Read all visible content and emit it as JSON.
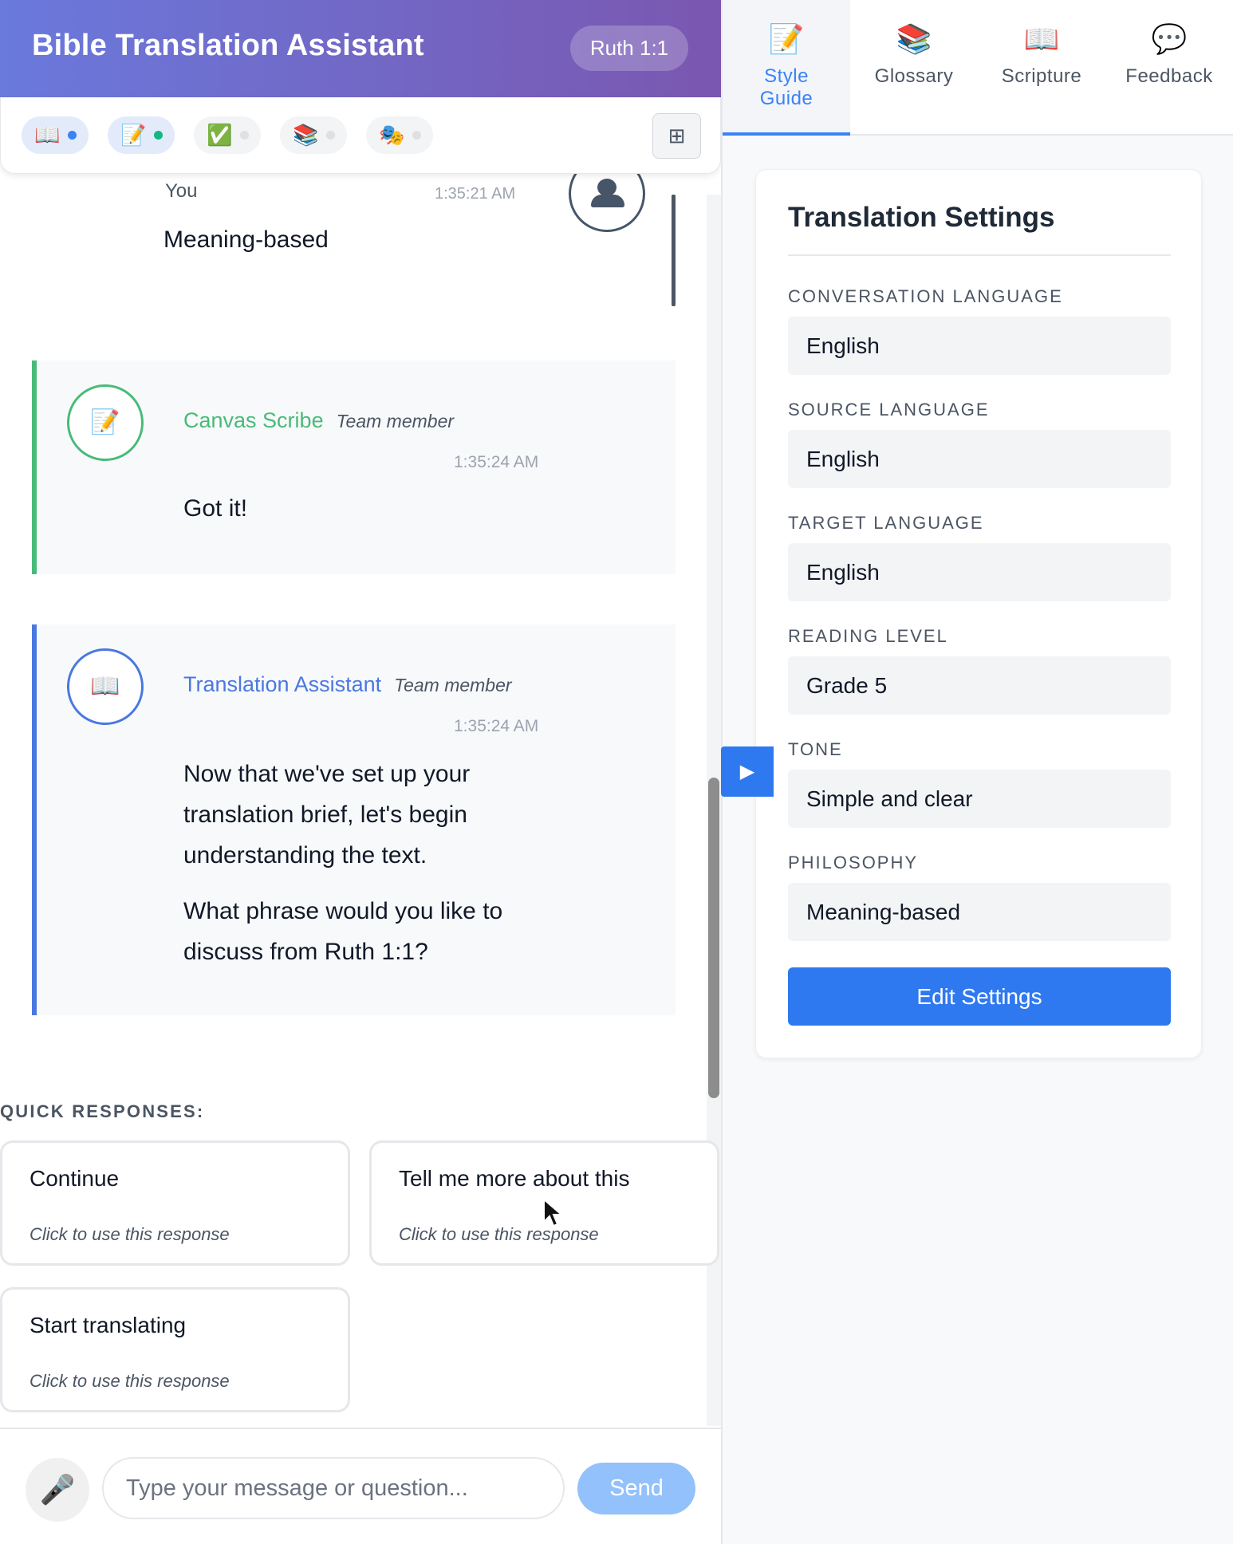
{
  "header": {
    "title": "Bible Translation Assistant",
    "reference": "Ruth 1:1"
  },
  "agent_bar": {
    "chips": [
      {
        "icon": "📖",
        "status_color": "#3b82f6"
      },
      {
        "icon": "📝",
        "status_color": "#10b981"
      },
      {
        "icon": "✅",
        "status_color": "#d1d5db"
      },
      {
        "icon": "📚",
        "status_color": "#d1d5db"
      },
      {
        "icon": "🎭",
        "status_color": "#d1d5db"
      }
    ],
    "grid_icon": "⊞"
  },
  "messages": {
    "user": {
      "name": "You",
      "time": "1:35:21 AM",
      "text": "Meaning-based"
    },
    "scribe": {
      "name": "Canvas Scribe",
      "role": "Team member",
      "time": "1:35:24 AM",
      "text": "Got it!",
      "icon": "📝",
      "color": "#48bb78"
    },
    "assistant": {
      "name": "Translation Assistant",
      "role": "Team member",
      "time": "1:35:24 AM",
      "icon": "📖",
      "color": "#4a78e0",
      "paragraph1": "Now that we've set up your translation brief, let's begin understanding the text.",
      "paragraph2": "What phrase would you like to discuss from Ruth 1:1?"
    }
  },
  "quick_responses": {
    "label": "QUICK RESPONSES:",
    "hint": "Click to use this response",
    "items": [
      "Continue",
      "Tell me more about this",
      "Start translating"
    ]
  },
  "composer": {
    "mic_icon": "🎤",
    "placeholder": "Type your message or question...",
    "send_label": "Send"
  },
  "tabs": [
    {
      "icon": "📝",
      "label": "Style Guide",
      "active": true
    },
    {
      "icon": "📚",
      "label": "Glossary",
      "active": false
    },
    {
      "icon": "📖",
      "label": "Scripture",
      "active": false
    },
    {
      "icon": "💬",
      "label": "Feedback",
      "active": false
    }
  ],
  "toggle": "▶",
  "settings": {
    "title": "Translation Settings",
    "fields": [
      {
        "label": "CONVERSATION LANGUAGE",
        "value": "English"
      },
      {
        "label": "SOURCE LANGUAGE",
        "value": "English"
      },
      {
        "label": "TARGET LANGUAGE",
        "value": "English"
      },
      {
        "label": "READING LEVEL",
        "value": "Grade 5"
      },
      {
        "label": "TONE",
        "value": "Simple and clear"
      },
      {
        "label": "PHILOSOPHY",
        "value": "Meaning-based"
      }
    ],
    "edit_label": "Edit Settings"
  },
  "colors": {
    "accent": "#2f79f0",
    "header_start": "#6a79dc",
    "header_end": "#7a57b0"
  }
}
